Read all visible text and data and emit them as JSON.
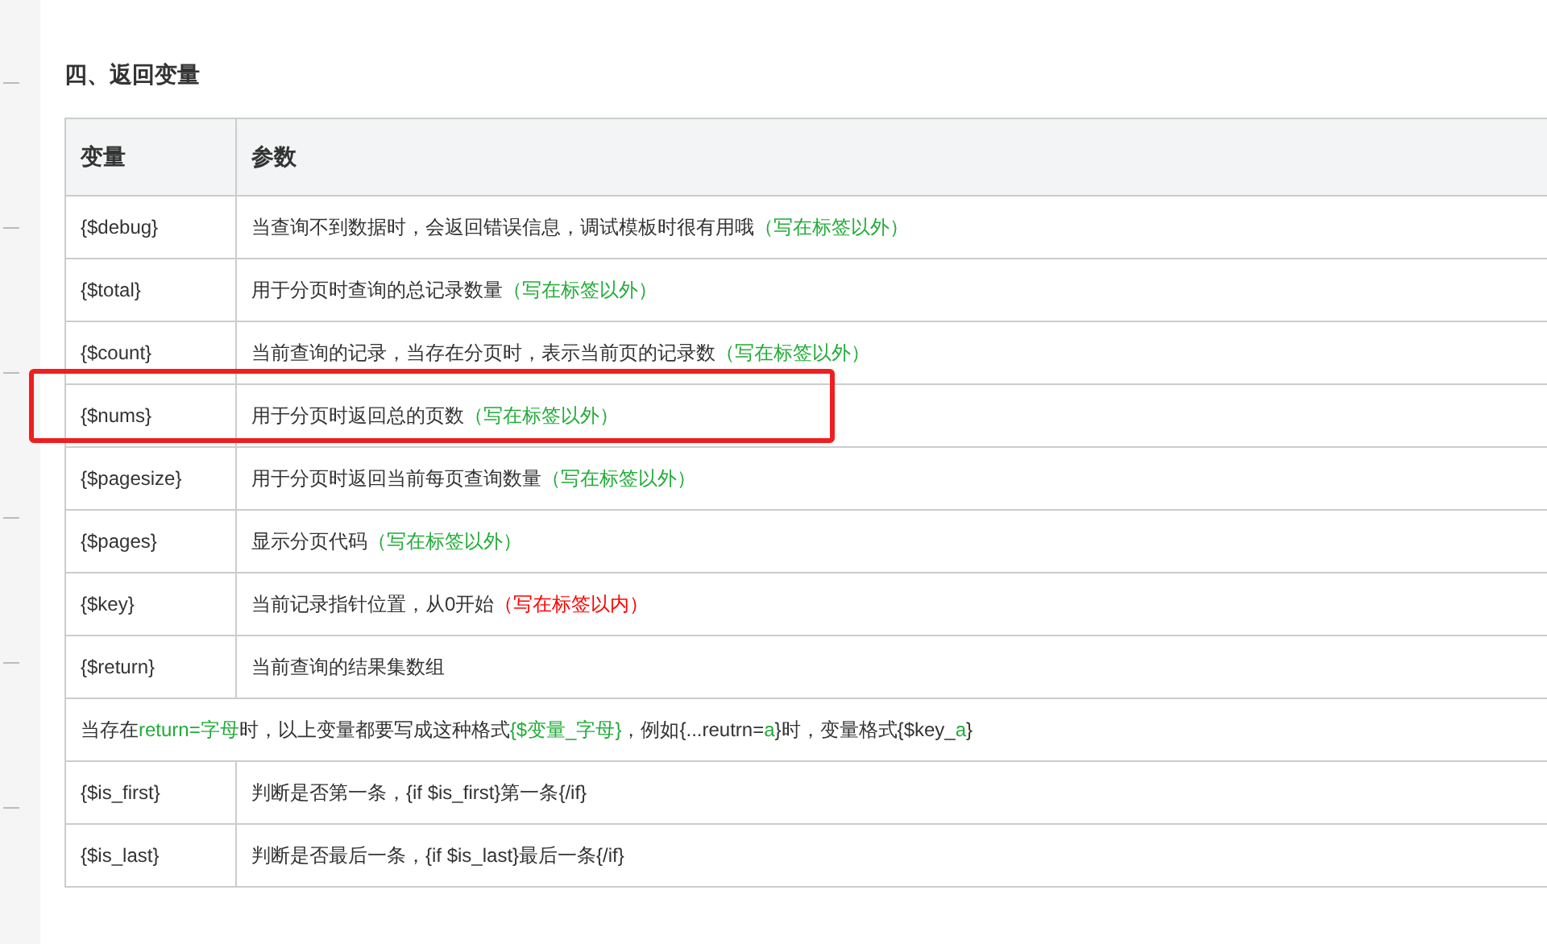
{
  "heading": "四、返回变量",
  "columns": [
    "变量",
    "参数"
  ],
  "rows": [
    {
      "kind": "pair",
      "variable": "{$debug}",
      "description": "当查询不到数据时，会返回错误信息，调试模板时很有用哦",
      "note": {
        "text": "（写在标签以外）",
        "color": "#22ac38"
      }
    },
    {
      "kind": "pair",
      "variable": "{$total}",
      "description": "用于分页时查询的总记录数量",
      "note": {
        "text": "（写在标签以外）",
        "color": "#22ac38"
      }
    },
    {
      "kind": "pair",
      "variable": "{$count}",
      "description": "当前查询的记录，当存在分页时，表示当前页的记录数",
      "note": {
        "text": "（写在标签以外）",
        "color": "#22ac38"
      }
    },
    {
      "kind": "pair",
      "variable": "{$nums}",
      "description": "用于分页时返回总的页数",
      "note": {
        "text": "（写在标签以外）",
        "color": "#22ac38"
      },
      "highlighted": true
    },
    {
      "kind": "pair",
      "variable": "{$pagesize}",
      "description": "用于分页时返回当前每页查询数量",
      "note": {
        "text": "（写在标签以外）",
        "color": "#22ac38"
      }
    },
    {
      "kind": "pair",
      "variable": "{$pages}",
      "description": "显示分页代码",
      "note": {
        "text": "（写在标签以外）",
        "color": "#22ac38"
      }
    },
    {
      "kind": "pair",
      "variable": "{$key}",
      "description": "当前记录指针位置，从0开始",
      "note": {
        "text": "（写在标签以内）",
        "color": "#ff0000"
      }
    },
    {
      "kind": "pair",
      "variable": "{$return}",
      "description": "当前查询的结果集数组"
    },
    {
      "kind": "span",
      "segments": [
        {
          "text": "当存在"
        },
        {
          "text": "return=字母",
          "color": "#22ac38"
        },
        {
          "text": "时，以上变量都要写成这种格式"
        },
        {
          "text": "{$变量_字母}",
          "color": "#22ac38"
        },
        {
          "text": "，例如{...reutrn="
        },
        {
          "text": "a",
          "color": "#22ac38"
        },
        {
          "text": "}时，变量格式{$key_"
        },
        {
          "text": "a",
          "color": "#22ac38"
        },
        {
          "text": "}"
        }
      ]
    },
    {
      "kind": "pair",
      "variable": "{$is_first}",
      "description": "判断是否第一条，{if $is_first}第一条{/if}"
    },
    {
      "kind": "pair",
      "variable": "{$is_last}",
      "description": "判断是否最后一条，{if $is_last}最后一条{/if}"
    }
  ]
}
